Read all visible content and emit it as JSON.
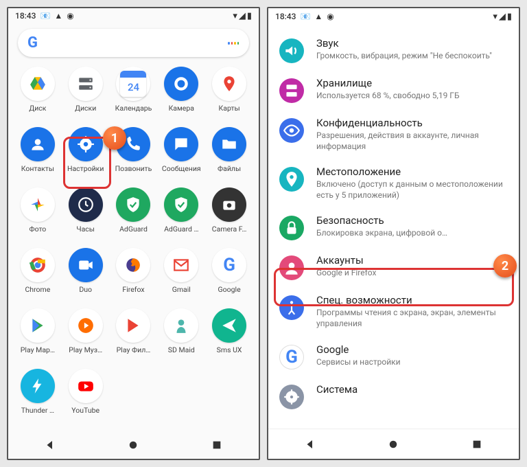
{
  "status": {
    "time": "18:43"
  },
  "search_placeholder": "",
  "callouts": {
    "one": "1",
    "two": "2"
  },
  "apps": [
    {
      "label": "Диск",
      "bg": "#fff",
      "glyph": "drive"
    },
    {
      "label": "Диски",
      "bg": "#fff",
      "glyph": "disks"
    },
    {
      "label": "Календарь",
      "bg": "#fff",
      "glyph": "calendar",
      "badge": "24"
    },
    {
      "label": "Камера",
      "bg": "#1a73e8",
      "glyph": "camera"
    },
    {
      "label": "Карты",
      "bg": "#fff",
      "glyph": "maps"
    },
    {
      "label": "Контакты",
      "bg": "#1a73e8",
      "glyph": "contact"
    },
    {
      "label": "Настройки",
      "bg": "#1a73e8",
      "glyph": "gear"
    },
    {
      "label": "Позвонить",
      "bg": "#1a73e8",
      "glyph": "phone"
    },
    {
      "label": "Сообщения",
      "bg": "#1a73e8",
      "glyph": "message"
    },
    {
      "label": "Файлы",
      "bg": "#1a73e8",
      "glyph": "folder"
    },
    {
      "label": "Фото",
      "bg": "#fff",
      "glyph": "photos"
    },
    {
      "label": "Часы",
      "bg": "#1f2b4a",
      "glyph": "clock"
    },
    {
      "label": "AdGuard",
      "bg": "#1fa860",
      "glyph": "shield"
    },
    {
      "label": "AdGuard …",
      "bg": "#1fa860",
      "glyph": "shield"
    },
    {
      "label": "Camera F…",
      "bg": "#333",
      "glyph": "cam2"
    },
    {
      "label": "Chrome",
      "bg": "#fff",
      "glyph": "chrome"
    },
    {
      "label": "Duo",
      "bg": "#1a73e8",
      "glyph": "duo"
    },
    {
      "label": "Firefox",
      "bg": "#fff",
      "glyph": "firefox"
    },
    {
      "label": "Gmail",
      "bg": "#fff",
      "glyph": "gmail"
    },
    {
      "label": "Google",
      "bg": "#fff",
      "glyph": "google"
    },
    {
      "label": "Play Мар…",
      "bg": "#fff",
      "glyph": "play"
    },
    {
      "label": "Play Муз…",
      "bg": "#fff",
      "glyph": "playmusic"
    },
    {
      "label": "Play Фил…",
      "bg": "#fff",
      "glyph": "playmovie"
    },
    {
      "label": "SD Maid",
      "bg": "#fff",
      "glyph": "sdmaid"
    },
    {
      "label": "Sms UX",
      "bg": "#10b58f",
      "glyph": "send"
    },
    {
      "label": "Thunder …",
      "bg": "#17b5e0",
      "glyph": "thunder"
    },
    {
      "label": "YouTube",
      "bg": "#fff",
      "glyph": "youtube"
    }
  ],
  "settings": [
    {
      "icon_bg": "#17b5c0",
      "glyph": "sound",
      "title": "Звук",
      "sub": "Громкость, вибрация, режим \"Не беспокоить\""
    },
    {
      "icon_bg": "#c02ba6",
      "glyph": "storage",
      "title": "Хранилище",
      "sub": "Используется 68 %, свободно 5,19 ГБ"
    },
    {
      "icon_bg": "#3b6eea",
      "glyph": "privacy",
      "title": "Конфиденциальность",
      "sub": "Разрешения, действия в аккаунте, личная информация"
    },
    {
      "icon_bg": "#17b5c0",
      "glyph": "location",
      "title": "Местоположение",
      "sub": "Включено (доступ к данным о местоположении есть у 5 приложений)"
    },
    {
      "icon_bg": "#1aa863",
      "glyph": "security",
      "title": "Безопасность",
      "sub": "Блокировка экрана, цифровой о…"
    },
    {
      "icon_bg": "#e34a7a",
      "glyph": "accounts",
      "title": "Аккаунты",
      "sub": "Google и Firefox"
    },
    {
      "icon_bg": "#3b6eea",
      "glyph": "a11y",
      "title": "Спец. возможности",
      "sub": "Программы чтения с экрана, экран, элементы управления"
    },
    {
      "icon_bg": "#fff",
      "glyph": "google",
      "title": "Google",
      "sub": "Сервисы и настройки"
    },
    {
      "icon_bg": "#8a94a6",
      "glyph": "system",
      "title": "Система",
      "sub": ""
    }
  ]
}
